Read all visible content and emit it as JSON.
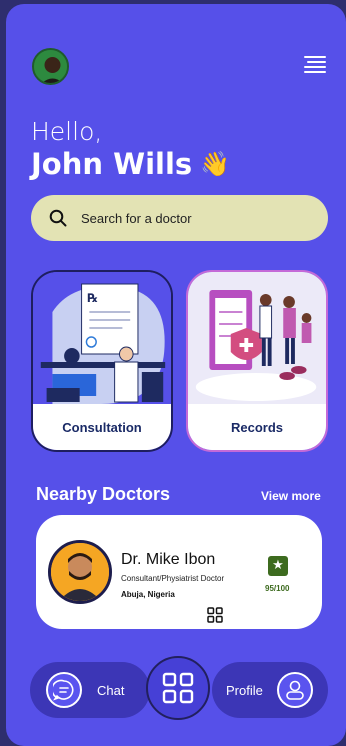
{
  "header": {
    "avatar_icon": "user-avatar",
    "menu_icon": "hamburger-menu-icon"
  },
  "greeting": {
    "hello": "Hello,",
    "name": "John Wills",
    "wave": "👋"
  },
  "search": {
    "placeholder": "Search for a doctor",
    "icon": "search-icon"
  },
  "cards": [
    {
      "label": "Consultation"
    },
    {
      "label": "Records"
    }
  ],
  "nearby": {
    "title": "Nearby Doctors",
    "view_more": "View more",
    "doctor": {
      "name": "Dr. Mike Ibon",
      "role": "Consultant/Physiatrist Doctor",
      "location": "Abuja, Nigeria",
      "star": "★",
      "rating": "95/100"
    }
  },
  "nav": {
    "chat": "Chat",
    "profile": "Profile"
  },
  "colors": {
    "background": "#5650e9",
    "search_bg": "#e3e3b4",
    "accent_green": "#3d6b1f"
  }
}
